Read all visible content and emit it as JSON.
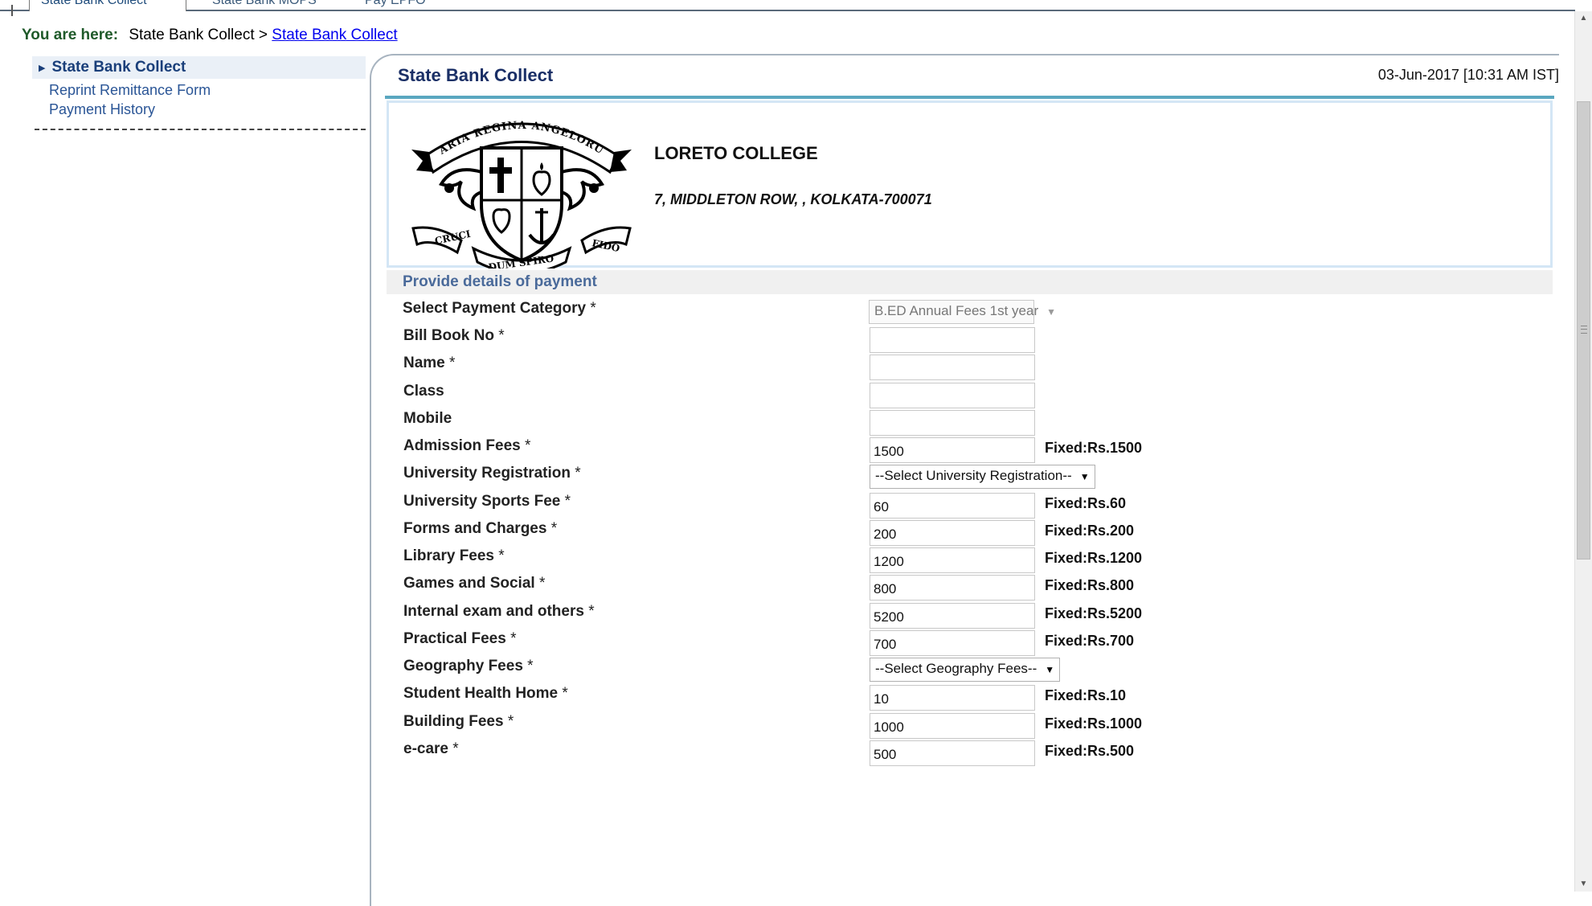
{
  "tabs": [
    {
      "label": "State Bank Collect",
      "active": true
    },
    {
      "label": "State Bank MOPS",
      "active": false
    },
    {
      "label": "Pay EPFO",
      "active": false
    }
  ],
  "breadcrumb": {
    "label": "You are here:",
    "path": "State Bank Collect",
    "separator": ">",
    "current": "State Bank Collect"
  },
  "sidebar": {
    "active_item": "State Bank Collect",
    "items": [
      "Reprint Remittance Form",
      "Payment History"
    ]
  },
  "panel": {
    "title": "State Bank Collect",
    "datetime": "03-Jun-2017 [10:31 AM IST]"
  },
  "institution": {
    "name": "LORETO COLLEGE",
    "address": "7, MIDDLETON ROW, , KOLKATA-700071",
    "logo_text": {
      "top": "MARIA REGINA ANGELORUM",
      "left": "CRUCI",
      "center": "DUM SPIRO",
      "right": "FIDO"
    }
  },
  "form": {
    "section_title": "Provide details of payment",
    "required_marker": "*",
    "category": {
      "label": "Select Payment Category",
      "value": "B.ED Annual Fees 1st year"
    },
    "fields": [
      {
        "label": "Bill Book No",
        "required": true,
        "value": ""
      },
      {
        "label": "Name",
        "required": true,
        "value": ""
      },
      {
        "label": "Class",
        "required": false,
        "value": ""
      },
      {
        "label": "Mobile",
        "required": false,
        "value": ""
      },
      {
        "label": "Admission Fees",
        "required": true,
        "value": "1500",
        "fixed": "Fixed:Rs.1500"
      },
      {
        "label": "University Registration",
        "required": true,
        "select": "--Select University Registration--"
      },
      {
        "label": "University Sports Fee",
        "required": true,
        "value": "60",
        "fixed": "Fixed:Rs.60"
      },
      {
        "label": "Forms and Charges",
        "required": true,
        "value": "200",
        "fixed": "Fixed:Rs.200"
      },
      {
        "label": "Library Fees",
        "required": true,
        "value": "1200",
        "fixed": "Fixed:Rs.1200"
      },
      {
        "label": "Games and Social",
        "required": true,
        "value": "800",
        "fixed": "Fixed:Rs.800"
      },
      {
        "label": "Internal exam and others",
        "required": true,
        "value": "5200",
        "fixed": "Fixed:Rs.5200"
      },
      {
        "label": "Practical Fees",
        "required": true,
        "value": "700",
        "fixed": "Fixed:Rs.700"
      },
      {
        "label": "Geography Fees",
        "required": true,
        "select": "--Select Geography Fees--"
      },
      {
        "label": "Student Health Home",
        "required": true,
        "value": "10",
        "fixed": "Fixed:Rs.10"
      },
      {
        "label": "Building Fees",
        "required": true,
        "value": "1000",
        "fixed": "Fixed:Rs.1000"
      },
      {
        "label": "e-care",
        "required": true,
        "value": "500",
        "fixed": "Fixed:Rs.500"
      }
    ]
  },
  "colors": {
    "title": "#1a2f66",
    "accent_bar": "#5aa7c0",
    "section_text": "#4a6a9a",
    "breadcrumb_label": "#1f5a2a",
    "link": "#0000ee"
  },
  "icons": {
    "nav_marker": "triangle-right-icon",
    "select_caret": "chevron-down-icon"
  }
}
